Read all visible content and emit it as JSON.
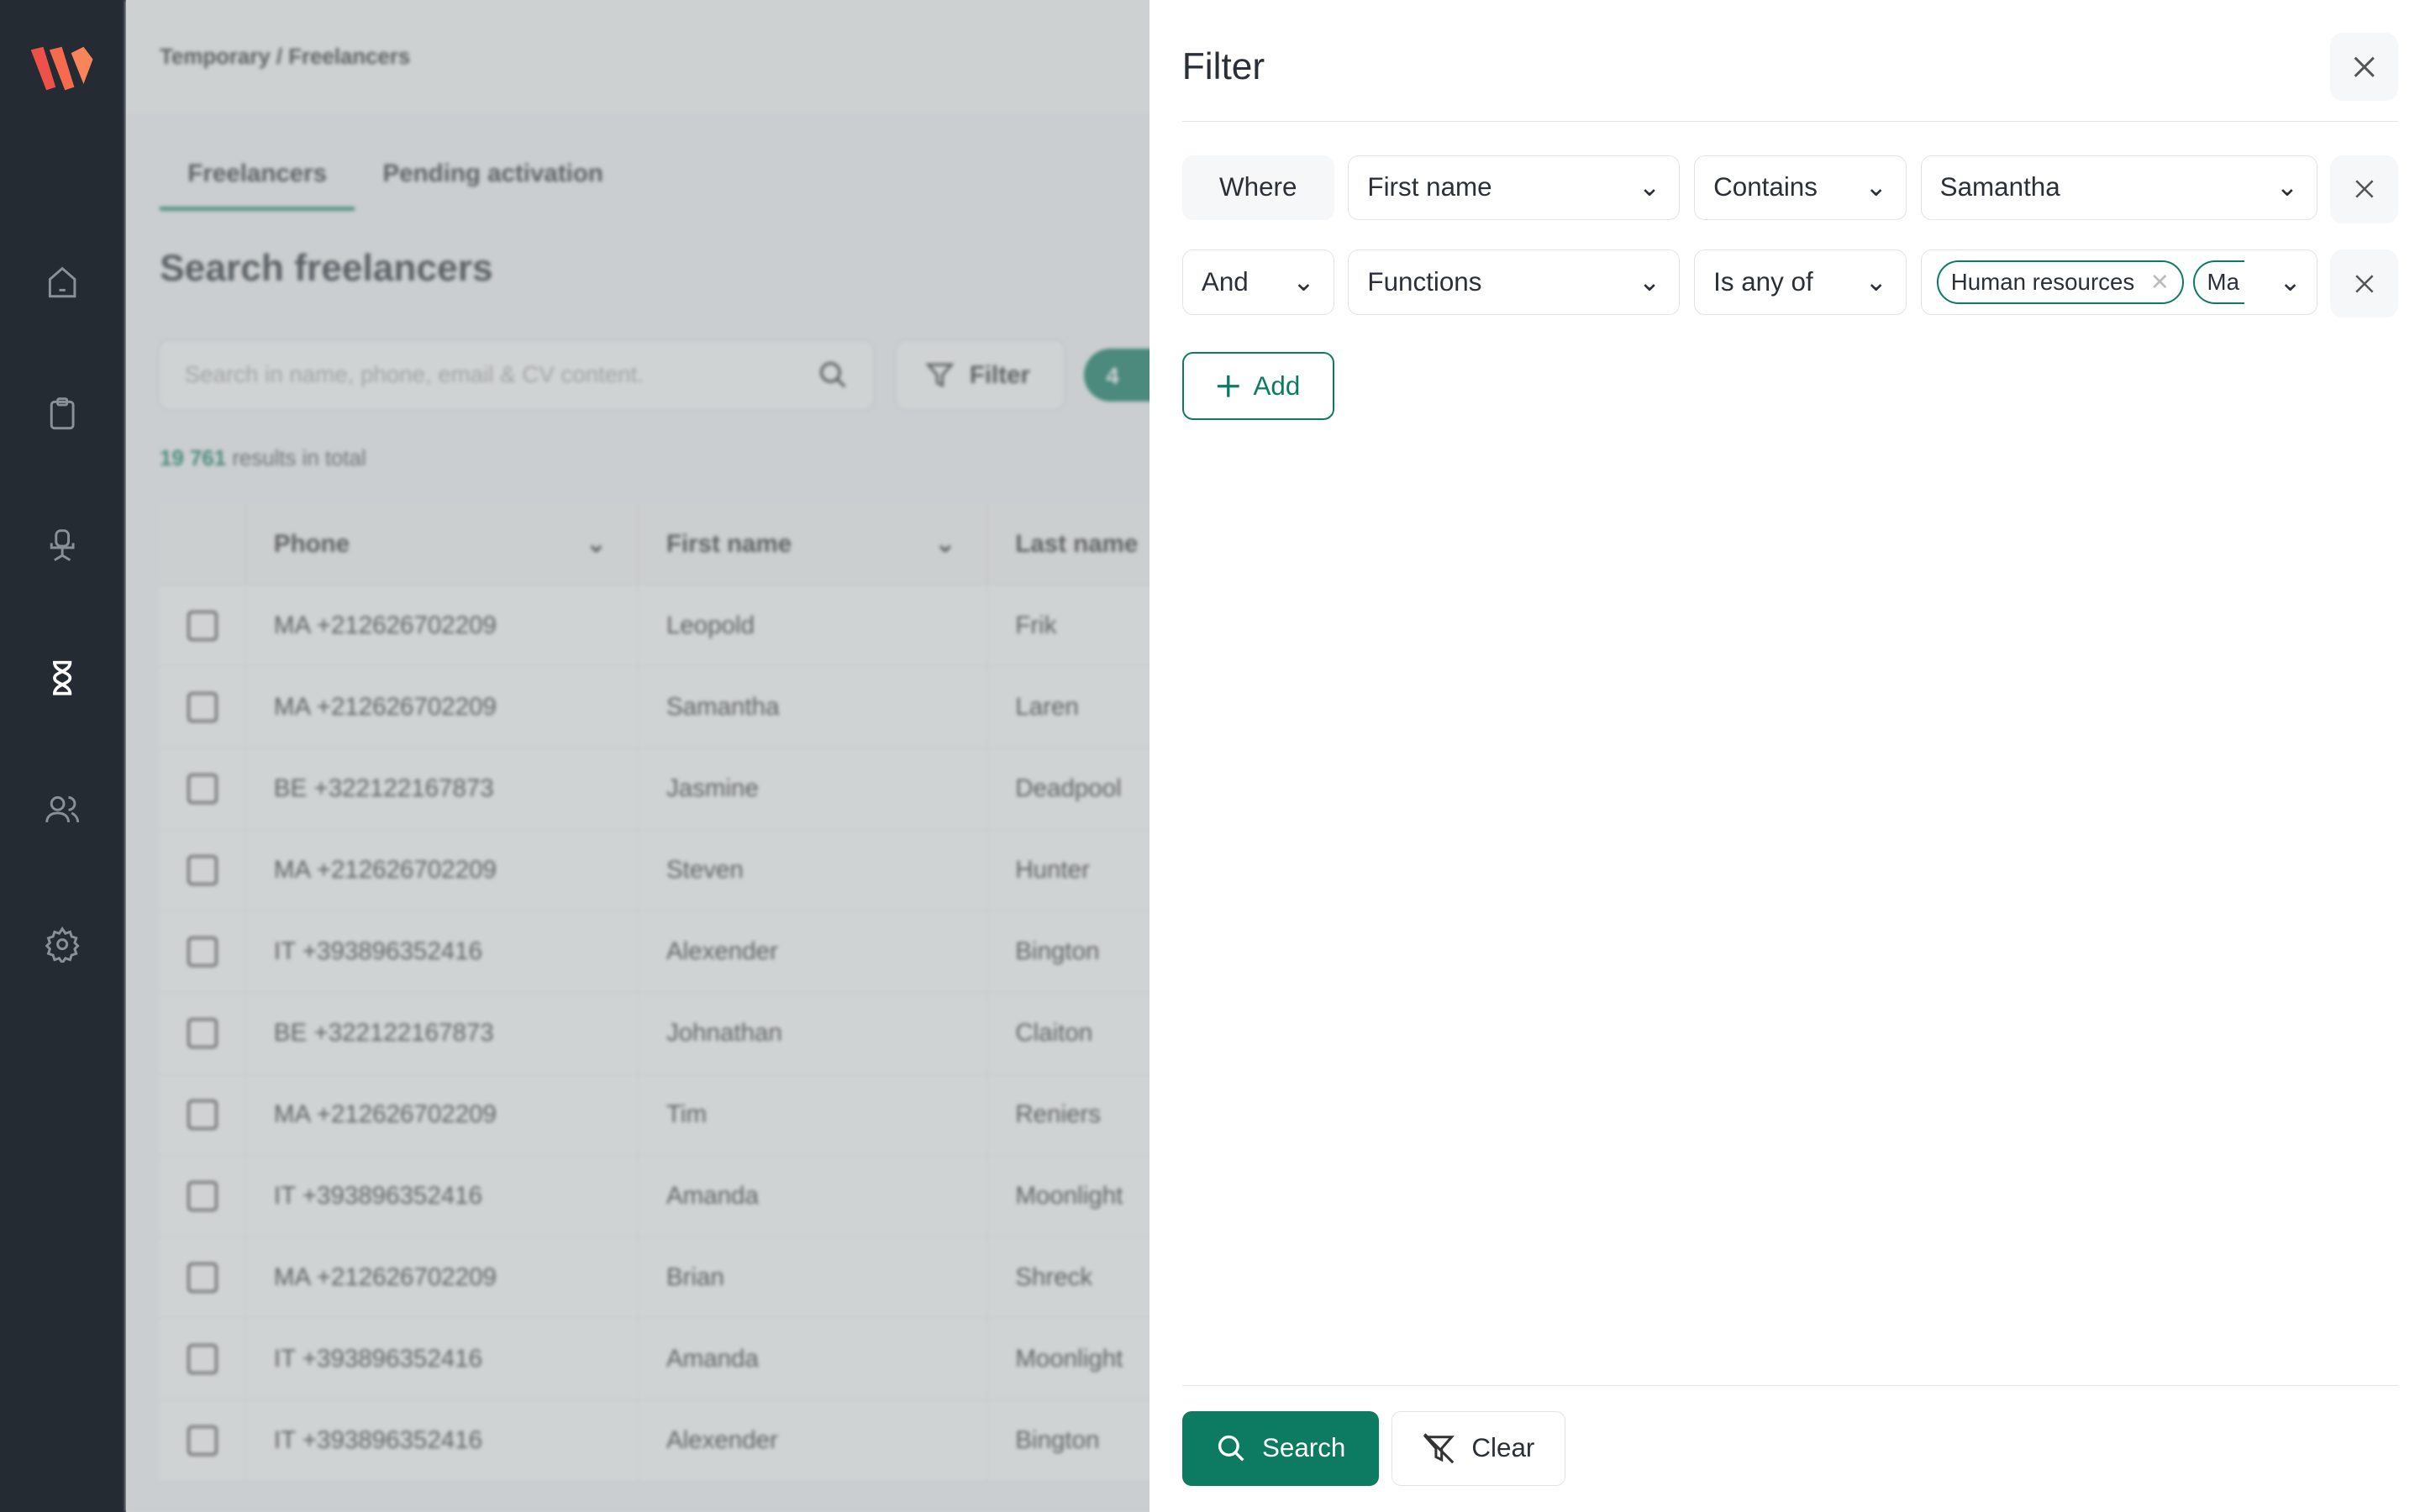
{
  "breadcrumb": {
    "parent": "Temporary",
    "separator": "/",
    "current": "Freelancers"
  },
  "tabs": [
    {
      "label": "Freelancers",
      "active": true
    },
    {
      "label": "Pending activation",
      "active": false
    }
  ],
  "page_title": "Search freelancers",
  "search": {
    "placeholder": "Search in name, phone, email & CV content."
  },
  "filter_button": "Filter",
  "filter_count": "4",
  "results": {
    "count": "19 761",
    "suffix": "results in total"
  },
  "table": {
    "columns": [
      "Phone",
      "First name",
      "Last name"
    ],
    "rows": [
      [
        "MA +212626702209",
        "Leopold",
        "Frik"
      ],
      [
        "MA +212626702209",
        "Samantha",
        "Laren"
      ],
      [
        "BE +322122167873",
        "Jasmine",
        "Deadpool"
      ],
      [
        "MA +212626702209",
        "Steven",
        "Hunter"
      ],
      [
        "IT +393896352416",
        "Alexender",
        "Bington"
      ],
      [
        "BE +322122167873",
        "Johnathan",
        "Claiton"
      ],
      [
        "MA +212626702209",
        "Tim",
        "Reniers"
      ],
      [
        "IT +393896352416",
        "Amanda",
        "Moonlight"
      ],
      [
        "MA +212626702209",
        "Brian",
        "Shreck"
      ],
      [
        "IT +393896352416",
        "Amanda",
        "Moonlight"
      ],
      [
        "IT +393896352416",
        "Alexender",
        "Bington"
      ]
    ]
  },
  "panel": {
    "title": "Filter",
    "rows": [
      {
        "conj": "Where",
        "field": "First name",
        "op": "Contains",
        "value": "Samantha"
      },
      {
        "conj": "And",
        "field": "Functions",
        "op": "Is any of",
        "chips": [
          "Human resources",
          "Ma"
        ]
      }
    ],
    "add_label": "Add",
    "search_label": "Search",
    "clear_label": "Clear"
  },
  "colors": {
    "accent": "#0d7a62",
    "sidebar": "#252b33"
  }
}
